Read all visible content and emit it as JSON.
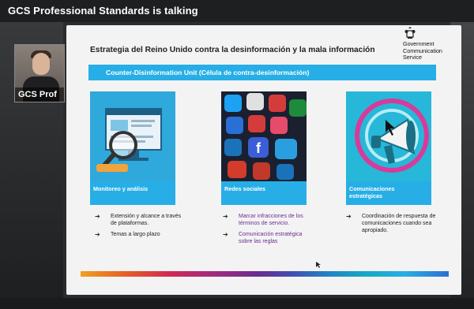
{
  "banner": {
    "title": "GCS Professional Standards is talking"
  },
  "camera": {
    "name": "GCS Prof"
  },
  "slide": {
    "title": "Estrategia del Reino Unido contra la desinformación y la mala información",
    "org_name_lines": [
      "Government",
      "Communication",
      "Service"
    ],
    "unit_label": "Counter-Disinformation Unit (Célula de contra-desinformación)",
    "cards": [
      {
        "caption": "Monitoreo y análisis",
        "image_icon": "monitoring-magnifier-illustration"
      },
      {
        "caption": "Redes sociales",
        "image_icon": "social-media-apps-illustration"
      },
      {
        "caption": "Comunicaciones estratégicas",
        "image_icon": "megaphone-illustration"
      }
    ],
    "bullets": [
      [
        "Extensión y alcance a través de plataformas.",
        "Temas a largo plazo"
      ],
      [
        "Marcar infracciones de los términos de servicio.",
        "Comunicación estratégica sobre las reglas"
      ],
      [
        "Coordinación de respuesta de comunicaciones cuando sea apropiado."
      ]
    ],
    "bullet_marker": "➔"
  },
  "colors": {
    "accent_blue": "#27aee6",
    "purple_text": "#6b2c91",
    "slide_background": "#f3f3f3",
    "frame_background": "#2a2c2e"
  }
}
